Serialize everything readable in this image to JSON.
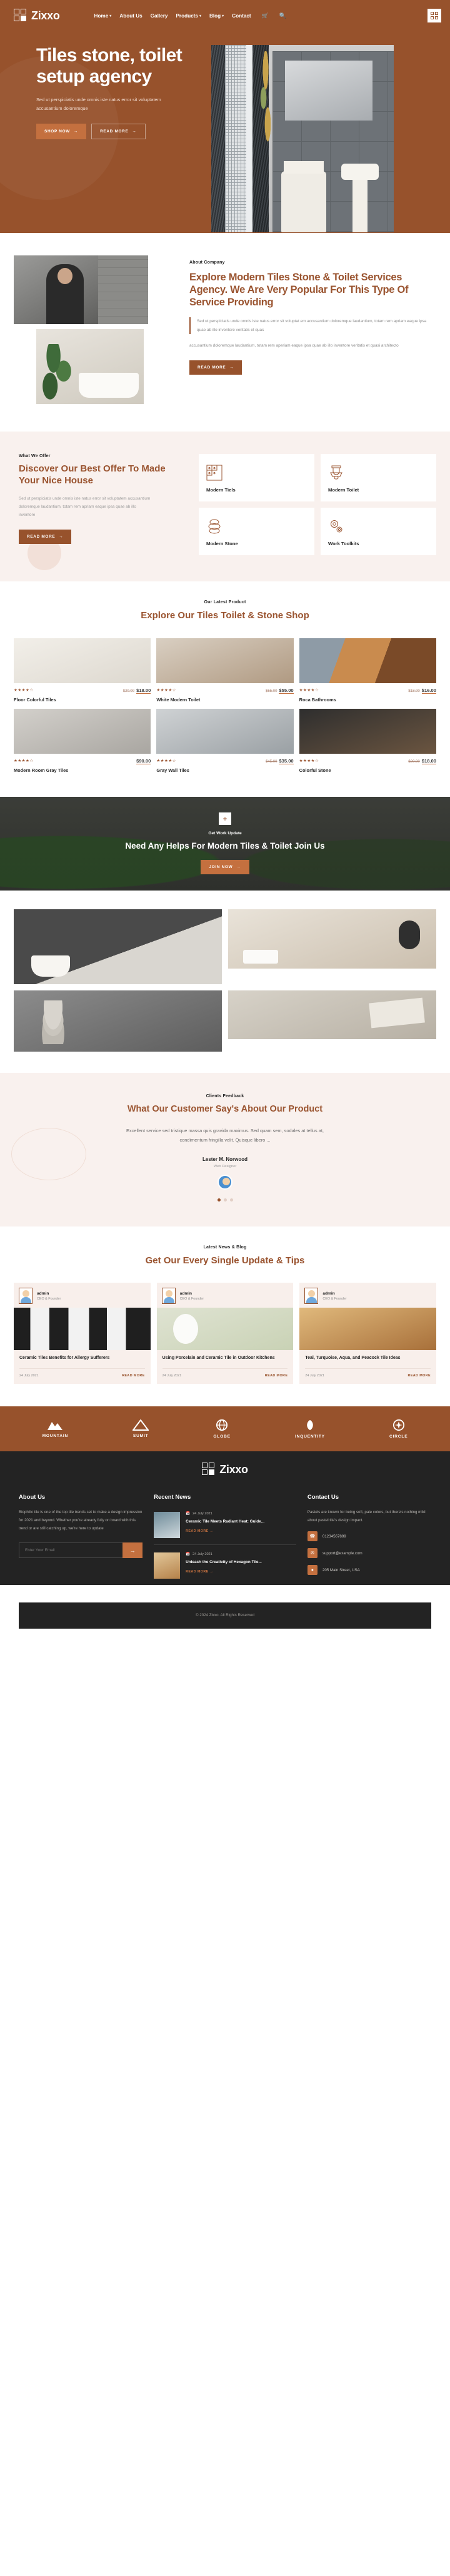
{
  "brand": {
    "name": "Zixxo",
    "logo_icon": "grid-blocks-icon"
  },
  "nav": {
    "items": [
      {
        "label": "Home",
        "has_caret": true
      },
      {
        "label": "About Us",
        "has_caret": false
      },
      {
        "label": "Gallery",
        "has_caret": false
      },
      {
        "label": "Products",
        "has_caret": true
      },
      {
        "label": "Blog",
        "has_caret": true
      },
      {
        "label": "Contact",
        "has_caret": false
      }
    ],
    "cart_icon": "shopping-cart-icon",
    "search_icon": "search-icon",
    "menu_icon": "grid-menu-icon"
  },
  "hero": {
    "title": "Tiles stone, toilet setup agency",
    "paragraph": "Sed ut perspiciatis unde omnis iste natus error sit voluptatem accusantium doloremque",
    "primary_btn": "SHOP NOW",
    "secondary_btn": "READ MORE",
    "arrow_icon": "arrow-right-icon",
    "bg_color": "#97522c"
  },
  "about": {
    "eyebrow": "About Company",
    "heading": "Explore Modern Tiles Stone & Toilet Services Agency. We Are Very Popular For This Type Of Service Providing",
    "quote": "Sed ut perspiciatis unde omnis iste natus error sit voluptat em accusantium doloremque laudantium, totam rem apriam eaque ipsa quae ab illo inventore veritatis et quas",
    "paragraph": "accusantium doloremque laudantium, totam rem aperiam eaque ipsa quae ab illo inventore veritatis et quasi architecto",
    "button": "READ MORE"
  },
  "offer": {
    "eyebrow": "What We Offer",
    "heading": "Discover Our Best Offer To Made Your Nice House",
    "paragraph": "Sed ut perspiciatis unde omnis iste natus error sit voluptatem accusantium doloremque laudantium, totam rem apriam eaque ipsa quae ab illo inventore",
    "button": "READ MORE",
    "cards": [
      {
        "label": "Modern Tiels",
        "icon": "tiles-grid-icon"
      },
      {
        "label": "Modern Toilet",
        "icon": "toilet-icon"
      },
      {
        "label": "Modern Stone",
        "icon": "stacked-stones-icon"
      },
      {
        "label": "Work Toolkits",
        "icon": "gears-icon"
      }
    ]
  },
  "products": {
    "eyebrow": "Our Latest Product",
    "heading": "Explore Our Tiles Toilet & Stone Shop",
    "items": [
      {
        "name": "Floor Colorful Tiles",
        "old_price": "$20.00",
        "new_price": "$18.00",
        "stars": "★★★★☆"
      },
      {
        "name": "White Modern Toilet",
        "old_price": "$65.00",
        "new_price": "$55.00",
        "stars": "★★★★☆"
      },
      {
        "name": "Roca Bathrooms",
        "old_price": "$18.00",
        "new_price": "$16.00",
        "stars": "★★★★☆"
      },
      {
        "name": "Modern Room Gray Tiles",
        "old_price": "",
        "new_price": "$90.00",
        "stars": "★★★★☆"
      },
      {
        "name": "Gray Wall Tiles",
        "old_price": "$45.00",
        "new_price": "$35.00",
        "stars": "★★★★☆"
      },
      {
        "name": "Colorful Stone",
        "old_price": "$20.00",
        "new_price": "$18.00",
        "stars": "★★★★☆"
      }
    ]
  },
  "cta": {
    "eyebrow": "Get Work Update",
    "heading": "Need Any Helps For Modern Tiles & Toilet Join Us",
    "button": "JOIN NOW",
    "plus_icon": "plus-icon"
  },
  "testimonial": {
    "eyebrow": "Clients Feedback",
    "heading": "What Our Customer Say's About Our Product",
    "quote": "Excellent service sed tristique massa quis gravida maximus. Sed quam sem, sodales at tellus at, condimentum fringilla velit. Quisque libero ...",
    "name": "Lester M. Norwood",
    "role": "Web Designer",
    "dots": 3,
    "active_dot": 0
  },
  "blog": {
    "eyebrow": "Latest News & Blog",
    "heading": "Get Our Every Single Update & Tips",
    "posts": [
      {
        "author": "admin",
        "role": "CEO & Founder",
        "title": "Ceramic Tiles Benefits for Allergy Sufferers",
        "date": "24 July 2021",
        "more": "READ MORE"
      },
      {
        "author": "admin",
        "role": "CEO & Founder",
        "title": "Using Porcelain and Ceramic Tile in Outdoor Kitchens",
        "date": "24 July 2021",
        "more": "READ MORE"
      },
      {
        "author": "admin",
        "role": "CEO & Founder",
        "title": "Teal, Turquoise, Aqua, and Peacock Tile Ideas",
        "date": "24 July 2021",
        "more": "READ MORE"
      }
    ]
  },
  "brands": [
    {
      "name": "MOUNTAIN",
      "icon": "mountain-icon"
    },
    {
      "name": "SUMIT",
      "icon": "peak-icon"
    },
    {
      "name": "GLOBE",
      "icon": "globe-icon"
    },
    {
      "name": "INQUENTITY",
      "icon": "leaf-icon"
    },
    {
      "name": "CIRCLE",
      "icon": "circle-star-icon"
    }
  ],
  "footer": {
    "brand": "Zixxo",
    "about": {
      "title": "About Us",
      "text": "Biophilic tile is one of the top tile trends set to make a design impression for 2021 and beyond. Whether you're already fully on board with this trend or are still catching up, we're here to update",
      "input_placeholder": "Enter Your Email",
      "submit_icon": "arrow-right-icon"
    },
    "news": {
      "title": "Recent News",
      "items": [
        {
          "date": "24 July 2021",
          "title": "Ceramic Tile Meets Radiant Heat: Guide...",
          "more": "READ MORE"
        },
        {
          "date": "24 July 2021",
          "title": "Unleash the Creativity of Hexagon Tile...",
          "more": "READ MORE"
        }
      ]
    },
    "contact": {
      "title": "Contact Us",
      "text": "Pastels are known for being soft, pale colors, but there's nothing mild about pastel tile's design impact.",
      "lines": [
        {
          "value": "01234567899",
          "icon": "phone-icon"
        },
        {
          "value": "support@example.com",
          "icon": "mail-icon"
        },
        {
          "value": "205 Main Street, USA",
          "icon": "location-pin-icon"
        }
      ]
    },
    "copyright": "© 2024 Zixxo. All Rights Reserved"
  }
}
